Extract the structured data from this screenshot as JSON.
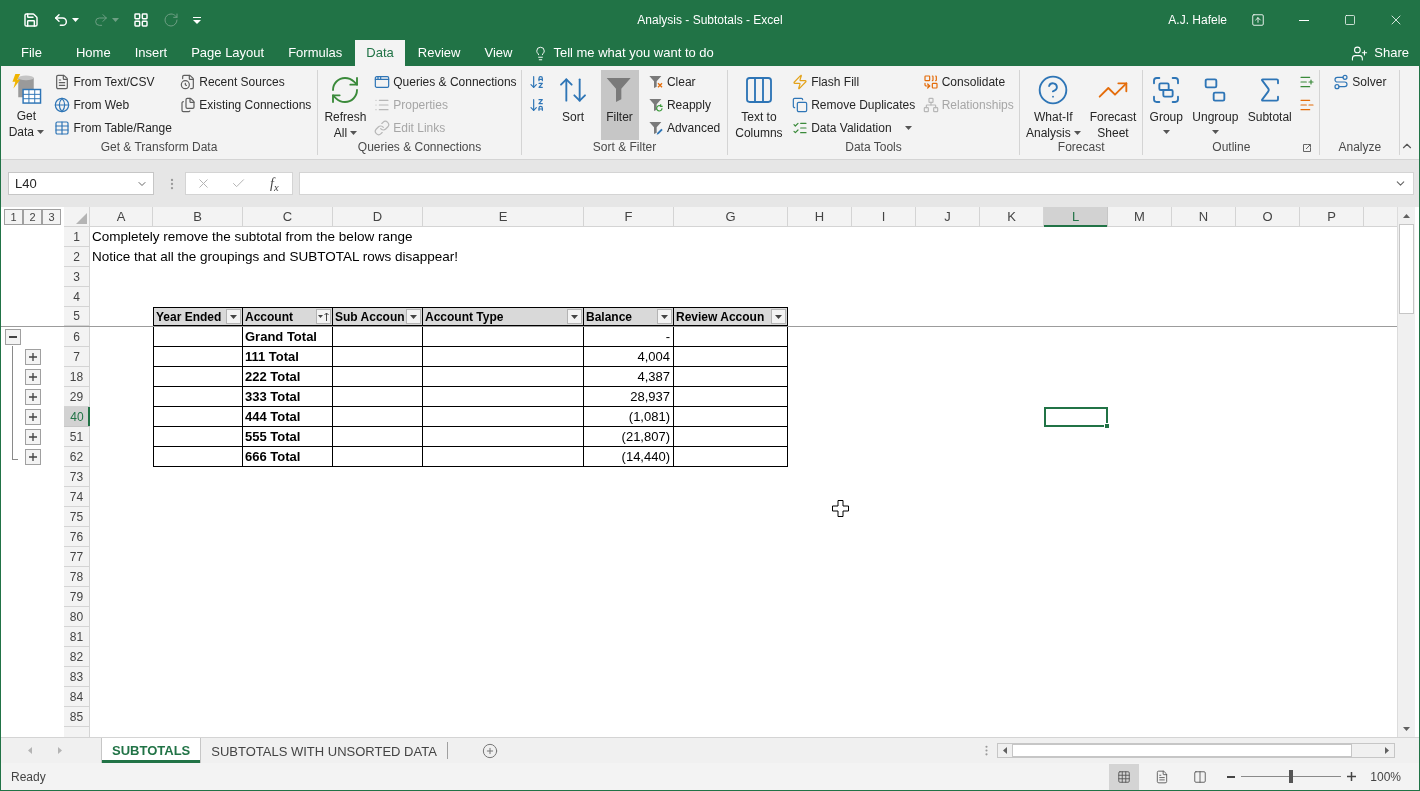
{
  "window": {
    "title": "Analysis - Subtotals - Excel",
    "user": "A.J. Hafele"
  },
  "quick_access": [
    {
      "kind": "save",
      "disabled": false
    },
    {
      "kind": "undo",
      "disabled": false
    },
    {
      "kind": "redo",
      "disabled": true
    },
    {
      "kind": "form",
      "disabled": false
    },
    {
      "kind": "repeat",
      "disabled": true
    },
    {
      "kind": "customize",
      "disabled": false
    }
  ],
  "window_controls": [
    {
      "kind": "ribbon_options"
    },
    {
      "kind": "minimize"
    },
    {
      "kind": "maximize"
    },
    {
      "kind": "close"
    }
  ],
  "ribbon_tabs": [
    {
      "label": "File",
      "selected": false
    },
    {
      "label": "Home",
      "selected": false
    },
    {
      "label": "Insert",
      "selected": false
    },
    {
      "label": "Page Layout",
      "selected": false
    },
    {
      "label": "Formulas",
      "selected": false
    },
    {
      "label": "Data",
      "selected": true
    },
    {
      "label": "Review",
      "selected": false
    },
    {
      "label": "View",
      "selected": false
    }
  ],
  "tell_me": {
    "placeholder": "Tell me what you want to do"
  },
  "share": {
    "label": "Share"
  },
  "ribbon_groups": [
    {
      "label": "Get & Transform Data",
      "launcher": false,
      "commands": [
        {
          "kind": "large",
          "label": "Get\nData",
          "dropdown": true,
          "disabled": false,
          "pressed": false
        },
        {
          "kind": "small",
          "label": "From Text/CSV",
          "dropdown": false,
          "disabled": false,
          "pressed": false
        },
        {
          "kind": "small",
          "label": "From Web",
          "dropdown": false,
          "disabled": false,
          "pressed": false
        },
        {
          "kind": "small",
          "label": "From Table/Range",
          "dropdown": false,
          "disabled": false,
          "pressed": false
        },
        {
          "kind": "small",
          "label": "Recent Sources",
          "dropdown": false,
          "disabled": false,
          "pressed": false
        },
        {
          "kind": "small",
          "label": "Existing Connections",
          "dropdown": false,
          "disabled": false,
          "pressed": false
        }
      ]
    },
    {
      "label": "Queries & Connections",
      "launcher": false,
      "commands": [
        {
          "kind": "large",
          "label": "Refresh\nAll",
          "dropdown": true,
          "disabled": false,
          "pressed": false
        },
        {
          "kind": "small",
          "label": "Queries & Connections",
          "dropdown": false,
          "disabled": false,
          "pressed": false
        },
        {
          "kind": "small",
          "label": "Properties",
          "dropdown": false,
          "disabled": true,
          "pressed": false
        },
        {
          "kind": "small",
          "label": "Edit Links",
          "dropdown": false,
          "disabled": true,
          "pressed": false
        }
      ]
    },
    {
      "label": "Sort & Filter",
      "launcher": false,
      "commands": [
        {
          "kind": "small",
          "dropdown": false,
          "disabled": false,
          "pressed": false
        },
        {
          "kind": "small",
          "dropdown": false,
          "disabled": false,
          "pressed": false
        },
        {
          "kind": "large",
          "label": "Sort",
          "dropdown": false,
          "disabled": false,
          "pressed": false
        },
        {
          "kind": "large",
          "label": "Filter",
          "dropdown": false,
          "disabled": false,
          "pressed": true
        },
        {
          "kind": "small",
          "label": "Clear",
          "dropdown": false,
          "disabled": false,
          "pressed": false
        },
        {
          "kind": "small",
          "label": "Reapply",
          "dropdown": false,
          "disabled": false,
          "pressed": false
        },
        {
          "kind": "small",
          "label": "Advanced",
          "dropdown": false,
          "disabled": false,
          "pressed": false
        }
      ]
    },
    {
      "label": "Data Tools",
      "launcher": false,
      "commands": [
        {
          "kind": "large",
          "label": "Text to\nColumns",
          "dropdown": false,
          "disabled": false,
          "pressed": false
        },
        {
          "kind": "small",
          "label": "Flash Fill",
          "dropdown": false,
          "disabled": false,
          "pressed": false
        },
        {
          "kind": "small",
          "label": "Remove Duplicates",
          "dropdown": false,
          "disabled": false,
          "pressed": false
        },
        {
          "kind": "small",
          "label": "Data Validation",
          "dropdown": true,
          "disabled": false,
          "pressed": false
        },
        {
          "kind": "small",
          "label": "Consolidate",
          "dropdown": false,
          "disabled": false,
          "pressed": false
        },
        {
          "kind": "small",
          "label": "Relationships",
          "dropdown": false,
          "disabled": true,
          "pressed": false
        }
      ]
    },
    {
      "label": "Forecast",
      "launcher": false,
      "commands": [
        {
          "kind": "large",
          "label": "What-If\nAnalysis",
          "dropdown": true,
          "disabled": false,
          "pressed": false
        },
        {
          "kind": "large",
          "label": "Forecast\nSheet",
          "dropdown": false,
          "disabled": false,
          "pressed": false
        }
      ]
    },
    {
      "label": "Outline",
      "launcher": true,
      "commands": [
        {
          "kind": "large",
          "label": "Group",
          "dropdown": true,
          "disabled": false,
          "pressed": false
        },
        {
          "kind": "large",
          "label": "Ungroup",
          "dropdown": true,
          "disabled": false,
          "pressed": false
        },
        {
          "kind": "large",
          "label": "Subtotal",
          "dropdown": false,
          "disabled": false,
          "pressed": false
        },
        {
          "kind": "small",
          "dropdown": false,
          "disabled": false,
          "pressed": false
        },
        {
          "kind": "small",
          "dropdown": false,
          "disabled": false,
          "pressed": false
        }
      ]
    },
    {
      "label": "Analyze",
      "launcher": false,
      "commands": [
        {
          "kind": "small",
          "label": "Solver",
          "dropdown": false,
          "disabled": false,
          "pressed": false
        }
      ]
    }
  ],
  "formula_bar": {
    "name_box": "L40",
    "function_label": "f$_{x}$"
  },
  "outline_levels": [
    "1",
    "2",
    "3"
  ],
  "columns": [
    {
      "label": "A",
      "selected": false
    },
    {
      "label": "B",
      "selected": false
    },
    {
      "label": "C",
      "selected": false
    },
    {
      "label": "D",
      "selected": false
    },
    {
      "label": "E",
      "selected": false
    },
    {
      "label": "F",
      "selected": false
    },
    {
      "label": "G",
      "selected": false
    },
    {
      "label": "H",
      "selected": false
    },
    {
      "label": "I",
      "selected": false
    },
    {
      "label": "J",
      "selected": false
    },
    {
      "label": "K",
      "selected": false
    },
    {
      "label": "L",
      "selected": true
    },
    {
      "label": "M",
      "selected": false
    },
    {
      "label": "N",
      "selected": false
    },
    {
      "label": "O",
      "selected": false
    },
    {
      "label": "P",
      "selected": false
    }
  ],
  "table_columns": [
    {
      "label": "Year Ended",
      "sorted": false
    },
    {
      "label": "Account",
      "sorted": true
    },
    {
      "label": "Sub Accoun",
      "sorted": false
    },
    {
      "label": "Account Type",
      "sorted": false
    },
    {
      "label": "Balance",
      "sorted": false
    },
    {
      "label": "Review Accoun",
      "sorted": false
    }
  ],
  "rows": [
    {
      "header": "1",
      "selected": false,
      "kind": "note",
      "text": "Completely remove the subtotal from the below range"
    },
    {
      "header": "2",
      "selected": false,
      "kind": "note",
      "text": "Notice that all the groupings and SUBTOTAL rows disappear!"
    },
    {
      "header": "3",
      "selected": false,
      "kind": "blank"
    },
    {
      "header": "4",
      "selected": false,
      "kind": "blank"
    },
    {
      "header": "5",
      "selected": false,
      "kind": "table_header"
    },
    {
      "header": "6",
      "selected": false,
      "kind": "table_row",
      "account": "Grand Total",
      "balance": "-",
      "expanded": true,
      "children": [
        {
          "header": "7",
          "selected": false,
          "kind": "table_row",
          "account": "111 Total",
          "balance": "4,004",
          "expanded": false
        },
        {
          "header": "18",
          "selected": false,
          "kind": "table_row",
          "account": "222 Total",
          "balance": "4,387",
          "expanded": false
        },
        {
          "header": "29",
          "selected": false,
          "kind": "table_row",
          "account": "333 Total",
          "balance": "28,937",
          "expanded": false
        },
        {
          "header": "40",
          "selected": true,
          "kind": "table_row",
          "account": "444 Total",
          "balance": "(1,081)",
          "expanded": false
        },
        {
          "header": "51",
          "selected": false,
          "kind": "table_row",
          "account": "555 Total",
          "balance": "(21,807)",
          "expanded": false
        },
        {
          "header": "62",
          "selected": false,
          "kind": "table_row",
          "account": "666 Total",
          "balance": "(14,440)",
          "expanded": false
        }
      ]
    },
    {
      "header": "73",
      "selected": false,
      "kind": "blank"
    },
    {
      "header": "74",
      "selected": false,
      "kind": "blank"
    },
    {
      "header": "75",
      "selected": false,
      "kind": "blank"
    },
    {
      "header": "76",
      "selected": false,
      "kind": "blank"
    },
    {
      "header": "77",
      "selected": false,
      "kind": "blank"
    },
    {
      "header": "78",
      "selected": false,
      "kind": "blank"
    },
    {
      "header": "79",
      "selected": false,
      "kind": "blank"
    },
    {
      "header": "80",
      "selected": false,
      "kind": "blank"
    },
    {
      "header": "81",
      "selected": false,
      "kind": "blank"
    },
    {
      "header": "82",
      "selected": false,
      "kind": "blank"
    },
    {
      "header": "83",
      "selected": false,
      "kind": "blank"
    },
    {
      "header": "84",
      "selected": false,
      "kind": "blank"
    },
    {
      "header": "85",
      "selected": false,
      "kind": "blank"
    }
  ],
  "sheet_tabs": [
    {
      "label": "SUBTOTALS",
      "selected": true
    },
    {
      "label": "SUBTOTALS WITH UNSORTED DATA",
      "selected": false
    }
  ],
  "status_bar": {
    "status": "Ready",
    "views": [
      {
        "kind": "normal",
        "selected": true
      },
      {
        "kind": "page_layout",
        "selected": false
      },
      {
        "kind": "page_break",
        "selected": false
      }
    ],
    "zoom": {
      "level": 0.5,
      "reading": "100%"
    }
  }
}
